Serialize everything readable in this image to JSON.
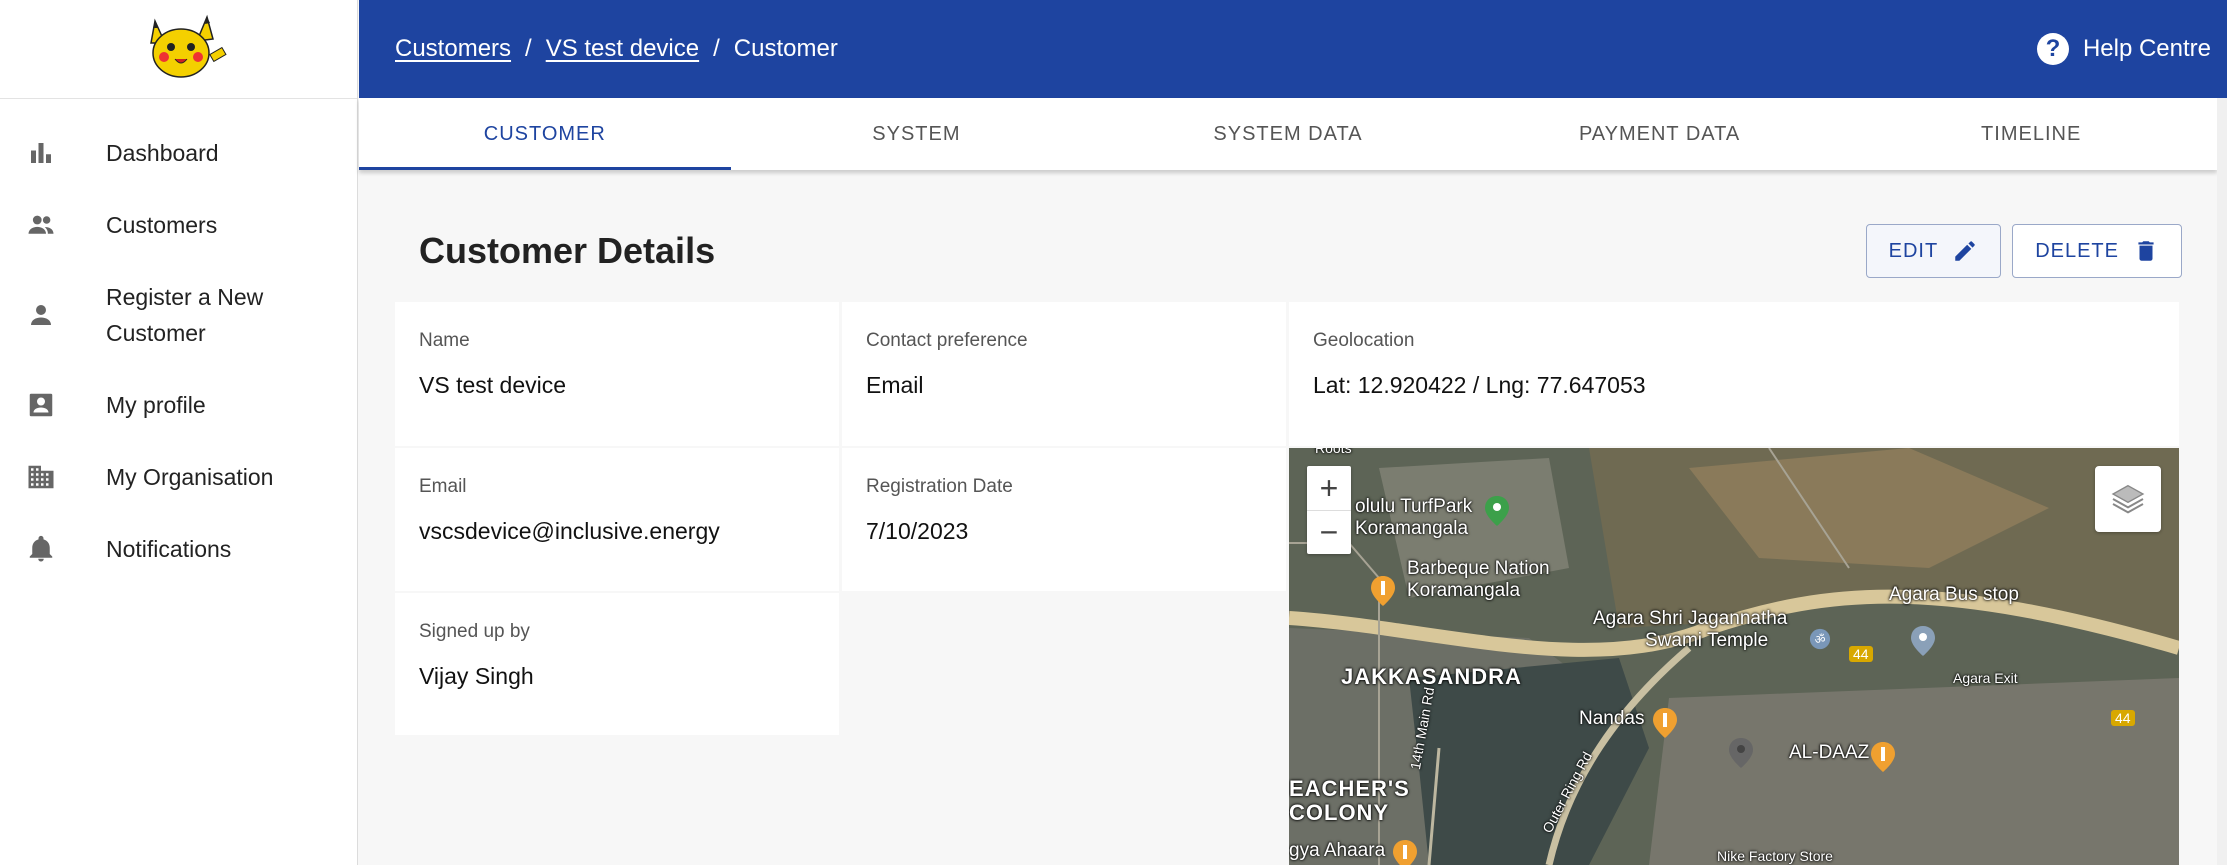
{
  "sidebar": {
    "items": [
      {
        "label": "Dashboard",
        "icon": "bar-chart-icon"
      },
      {
        "label": "Customers",
        "icon": "people-icon"
      },
      {
        "label": "Register a New Customer",
        "icon": "person-icon"
      },
      {
        "label": "My profile",
        "icon": "account-box-icon"
      },
      {
        "label": "My Organisation",
        "icon": "building-icon"
      },
      {
        "label": "Notifications",
        "icon": "bell-icon"
      }
    ]
  },
  "header": {
    "breadcrumb": [
      "Customers",
      "VS test device",
      "Customer"
    ],
    "separator": "/",
    "help_label": "Help Centre",
    "help_icon_glyph": "?"
  },
  "tabs": [
    {
      "label": "CUSTOMER",
      "active": true
    },
    {
      "label": "SYSTEM"
    },
    {
      "label": "SYSTEM DATA"
    },
    {
      "label": "PAYMENT DATA"
    },
    {
      "label": "TIMELINE"
    }
  ],
  "main": {
    "title": "Customer Details",
    "edit_label": "EDIT",
    "delete_label": "DELETE",
    "fields": {
      "name": {
        "label": "Name",
        "value": "VS test device"
      },
      "contact": {
        "label": "Contact preference",
        "value": "Email"
      },
      "geo": {
        "label": "Geolocation",
        "value": "Lat: 12.920422 / Lng: 77.647053"
      },
      "email": {
        "label": "Email",
        "value": "vscsdevice@inclusive.energy"
      },
      "regdate": {
        "label": "Registration Date",
        "value": "7/10/2023"
      },
      "signedup": {
        "label": "Signed up by",
        "value": "Vijay Singh"
      }
    }
  },
  "map": {
    "zoom_in": "+",
    "zoom_out": "−",
    "labels": {
      "roots": "Roots",
      "turfpark1": "olulu TurfPark",
      "turfpark2": "Koramangala",
      "bbq1": "Barbeque Nation",
      "bbq2": "Koramangala",
      "temple1": "Agara Shri Jagannatha",
      "temple2": "Swami Temple",
      "busstop": "Agara Bus stop",
      "jakkasandra": "JAKKASANDRA",
      "nandas": "Nandas",
      "aldaaz": "AL-DAAZ",
      "teachers1": "EACHER'S",
      "teachers2": "COLONY",
      "main14": "14th Main Rd",
      "outerring": "Outer Ring Rd",
      "agaraexit": "Agara Exit",
      "ahaara": "gya Ahaara",
      "nike": "Nike Factory Store",
      "nh44a": "44",
      "nh44b": "44"
    }
  },
  "colors": {
    "brand": "#1e44a0",
    "map_pin_food": "#f0a030",
    "map_pin_park": "#3ca04a"
  }
}
